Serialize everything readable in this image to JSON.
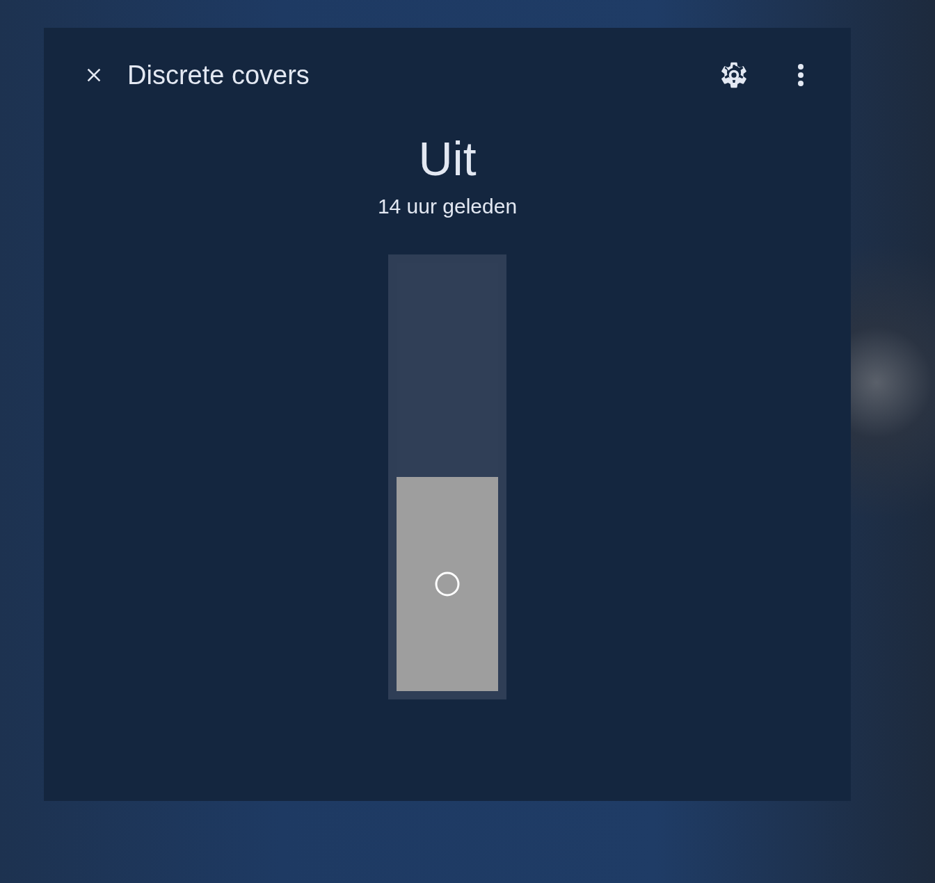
{
  "dialog": {
    "title": "Discrete covers"
  },
  "state": {
    "value": "Uit",
    "changed": "14 uur geleden"
  },
  "slider": {
    "level": 0.5
  }
}
